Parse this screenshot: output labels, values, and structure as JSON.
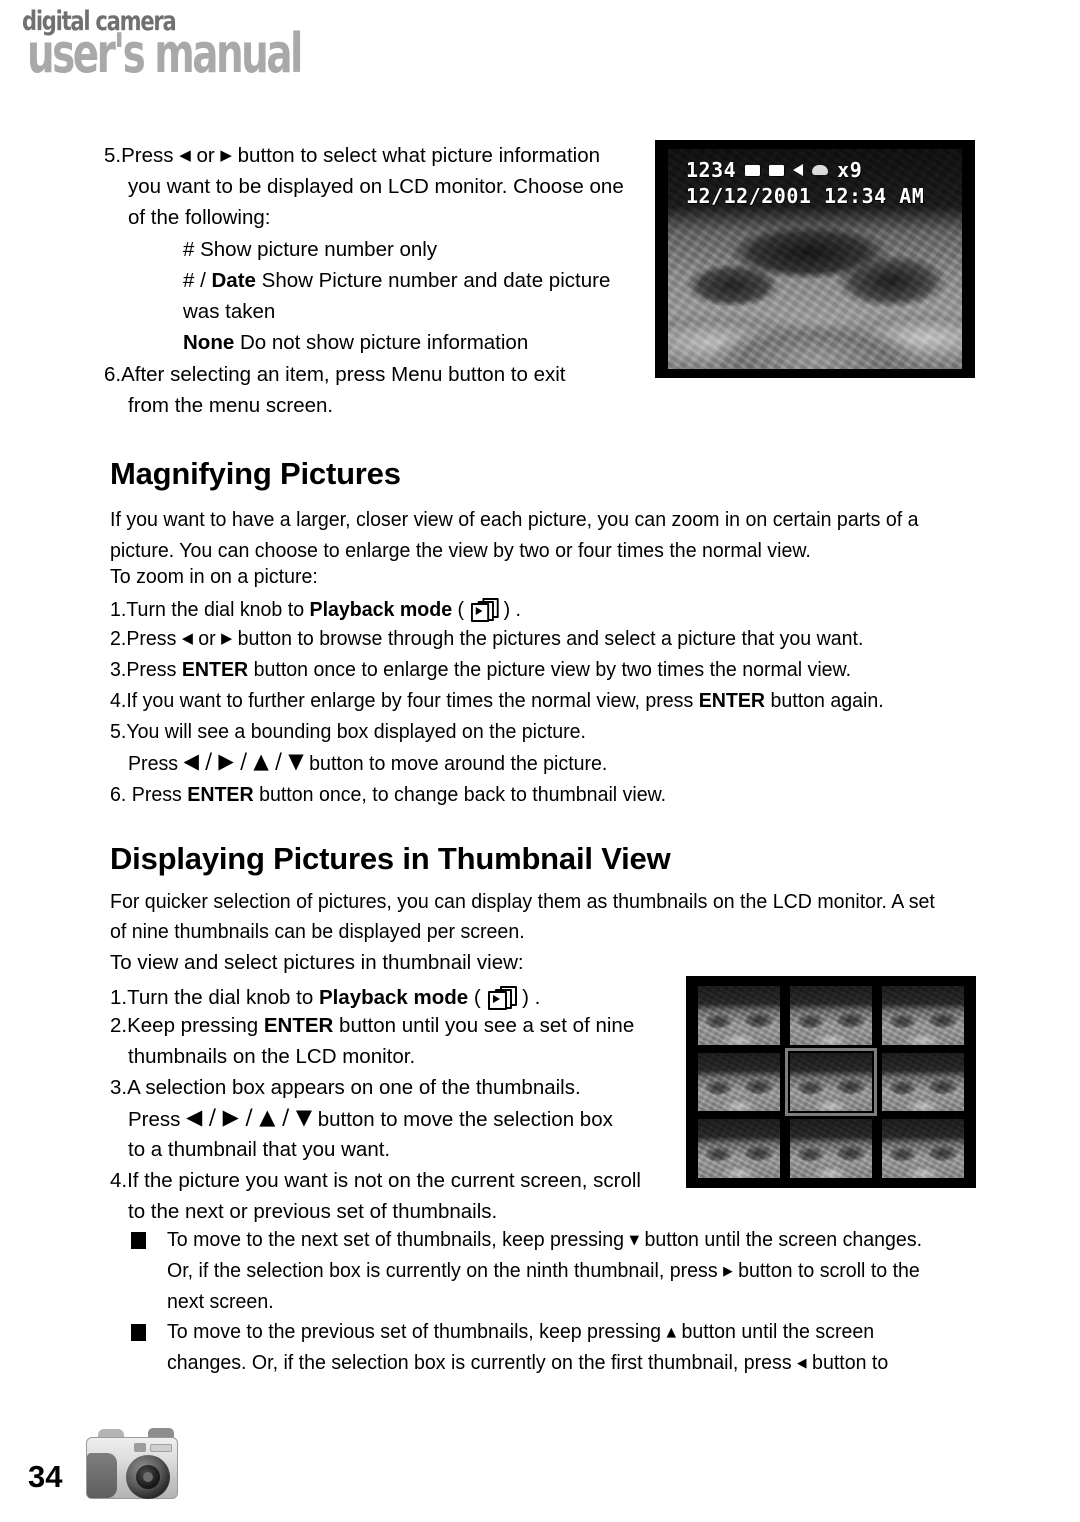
{
  "header": {
    "line1": "digital camera",
    "line2": "user's manual"
  },
  "footer": {
    "page_number": "34"
  },
  "colors": {
    "header_line1": "#707070",
    "header_line2": "#a9a9a9",
    "text": "#000000",
    "selection_box": "#7d7d7d",
    "background": "#ffffff"
  },
  "section_top": {
    "step5_line1_pre": "5.Press",
    "step5_left_arrow": "◀",
    "step5_or": "or",
    "step5_right_arrow": "▶",
    "step5_line1_post": "button to select what picture information",
    "step5_line2": "you want to be displayed on LCD monitor. Choose one",
    "step5_line3": "of the following:",
    "option1": "# Show picture number only",
    "option2_pre": "# /",
    "option2_bold": "Date",
    "option2_post": "Show Picture number and date picture",
    "option2_line2": "was taken",
    "option3_bold": "None",
    "option3_post": "Do not show picture information",
    "step6_line1": "6.After selecting an item, press Menu button to exit",
    "step6_line2": "from the menu screen."
  },
  "lcd_preview": {
    "picture_number": "1234",
    "zoom_label": "x9",
    "date": "12/12/2001",
    "time": "12:34 AM",
    "icons": [
      "memory-chip-icon",
      "memory-chip-icon",
      "speaker-icon",
      "battery-icon"
    ]
  },
  "magnifying": {
    "heading": "Magnifying Pictures",
    "intro_line1": "If you want to have a larger, closer view of each picture, you can zoom in on certain parts of a",
    "intro_line2": "picture. You can choose to enlarge the view by two or four times the normal view.",
    "intro_line3": "To zoom in on a picture:",
    "step1_pre": "1.Turn the dial knob to",
    "step1_bold": "Playback mode",
    "step1_paren_open": "(",
    "step1_paren_close": ") .",
    "step2_pre": "2.Press",
    "step2_left_arrow": "◀",
    "step2_or": "or",
    "step2_right_arrow": "▶",
    "step2_post": "button to browse through the pictures and select a picture that you want.",
    "step3_pre": "3.Press",
    "step3_bold": "ENTER",
    "step3_post": "button once to enlarge the picture view by two times the normal view.",
    "step4_pre": "4.If you want to further enlarge by four times the normal view, press",
    "step4_bold": "ENTER",
    "step4_post": "button again.",
    "step5": "5.You will see a bounding box displayed on the picture.",
    "step5_sub_pre": "Press",
    "step5_sub_arrows": "◀ / ▶ / ▲ / ▼",
    "step5_sub_post": "button to move around the picture.",
    "step6_pre": "6. Press",
    "step6_bold": "ENTER",
    "step6_post": "button once, to change back to thumbnail view."
  },
  "thumbnail_view": {
    "heading": "Displaying Pictures in Thumbnail View",
    "intro_line1": "For quicker selection of pictures, you can display them as thumbnails on the LCD monitor. A set",
    "intro_line2": "of nine thumbnails can be displayed per screen.",
    "intro_line3": "To view and select pictures in thumbnail view:",
    "step1_pre": "1.Turn the dial knob to",
    "step1_bold": "Playback mode",
    "step1_paren_open": "(",
    "step1_paren_close": ") .",
    "step2_pre": "2.Keep pressing",
    "step2_bold": "ENTER",
    "step2_post": "button until you see a set of nine",
    "step2_line2": "thumbnails on the LCD monitor.",
    "step3": "3.A selection box appears on one of the thumbnails.",
    "step3_sub_pre": "Press",
    "step3_sub_arrows": "◀ / ▶ / ▲ / ▼",
    "step3_sub_post": "button to move the selection box",
    "step3_sub_line2": "to a thumbnail that you want.",
    "step4_line1": "4.If the picture you want is not on the current screen, scroll",
    "step4_line2": "to the next or previous set of thumbnails.",
    "bullet1_line1_pre": "To move to the next set of thumbnails, keep pressing",
    "bullet1_arrow": "▼",
    "bullet1_line1_post": "button until the screen changes.",
    "bullet1_line2_pre": "Or, if the selection box is currently on the ninth thumbnail, press",
    "bullet1_line2_arrow": "▶",
    "bullet1_line2_post": "button to scroll to the",
    "bullet1_line3": "next screen.",
    "bullet2_line1_pre": "To move to the previous set of thumbnails, keep pressing",
    "bullet2_arrow": "▲",
    "bullet2_line1_post": "button until the screen",
    "bullet2_line2_pre": "changes. Or, if the selection box is currently on the first thumbnail, press",
    "bullet2_line2_arrow": "◀",
    "bullet2_line2_post": "button to"
  },
  "thumbnail_grid": {
    "rows": 3,
    "columns": 3,
    "count": 9,
    "selected_index": 4
  }
}
